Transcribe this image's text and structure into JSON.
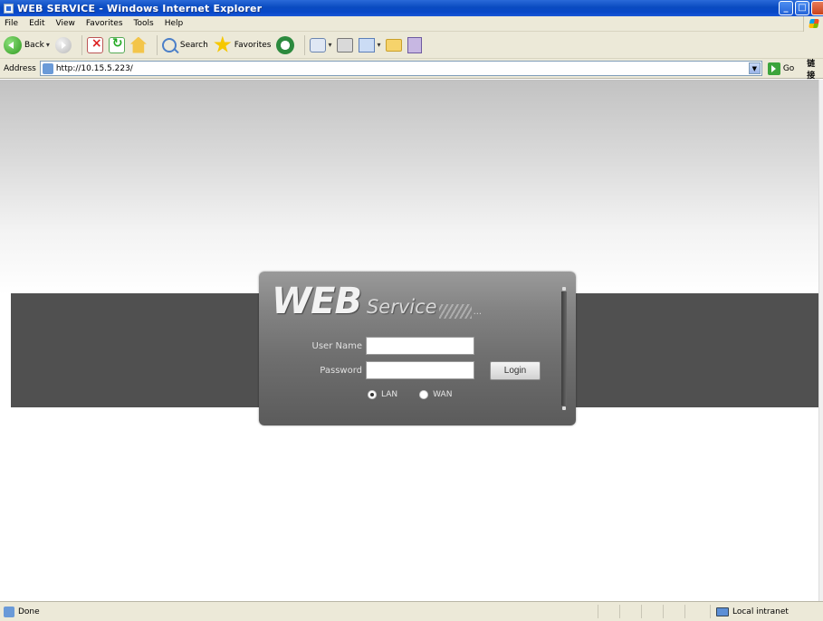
{
  "window": {
    "title": "WEB SERVICE - Windows Internet Explorer"
  },
  "menu": [
    {
      "label": "File"
    },
    {
      "label": "Edit"
    },
    {
      "label": "View"
    },
    {
      "label": "Favorites"
    },
    {
      "label": "Tools"
    },
    {
      "label": "Help"
    }
  ],
  "toolbar": {
    "back_label": "Back",
    "search_label": "Search",
    "favorites_label": "Favorites"
  },
  "address": {
    "label": "Address",
    "url": "http://10.15.5.223/",
    "go_label": "Go",
    "links_label": "链接"
  },
  "login": {
    "brand_web": "WEB",
    "brand_service": "Service",
    "brand_dots": "...",
    "username_label": "User Name",
    "username_value": "",
    "password_label": "Password",
    "password_value": "",
    "login_button": "Login",
    "radio_options": [
      {
        "label": "LAN",
        "checked": true
      },
      {
        "label": "WAN",
        "checked": false
      }
    ]
  },
  "status": {
    "text": "Done",
    "zone": "Local intranet"
  }
}
